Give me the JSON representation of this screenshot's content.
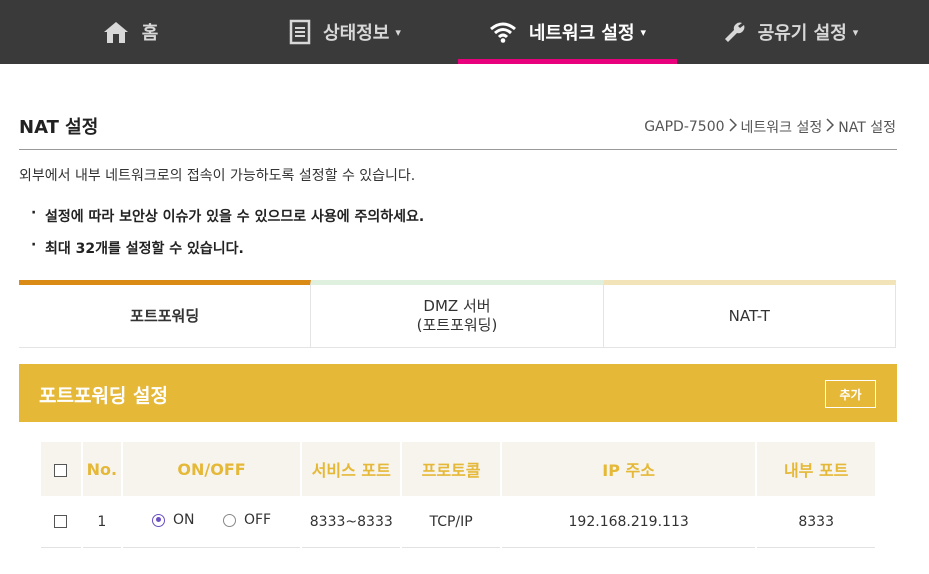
{
  "nav": {
    "items": [
      {
        "label": "홈",
        "icon": "home-icon",
        "caret": ""
      },
      {
        "label": "상태정보",
        "icon": "document-icon",
        "caret": "▾"
      },
      {
        "label": "네트워크 설정",
        "icon": "wifi-icon",
        "caret": "▾"
      },
      {
        "label": "공유기 설정",
        "icon": "wrench-icon",
        "caret": "▾"
      }
    ],
    "active_index": 2,
    "active_color": "#e8007d"
  },
  "page": {
    "title": "NAT 설정",
    "breadcrumb": [
      "GAPD-7500",
      "네트워크 설정",
      "NAT 설정"
    ],
    "description": "외부에서 내부 네트워크로의 접속이 가능하도록 설정할 수 있습니다.",
    "notes": [
      "설정에 따라 보안상 이슈가 있을 수 있으므로 사용에 주의하세요.",
      "최대 32개를 설정할 수 있습니다."
    ]
  },
  "tabs": [
    {
      "label": "포트포워딩",
      "sub": ""
    },
    {
      "label": "DMZ 서버",
      "sub": "(포트포워딩)"
    },
    {
      "label": "NAT-T",
      "sub": ""
    }
  ],
  "section": {
    "title": "포트포워딩 설정",
    "add_label": "추가",
    "accent_color": "#e5b838"
  },
  "table": {
    "headers": [
      "No.",
      "ON/OFF",
      "서비스 포트",
      "프로토콜",
      "IP 주소",
      "내부 포트"
    ],
    "rows": [
      {
        "no": "1",
        "on_label": "ON",
        "off_label": "OFF",
        "state": "ON",
        "service_port": "8333~8333",
        "protocol": "TCP/IP",
        "ip": "192.168.219.113",
        "internal_port": "8333"
      }
    ]
  }
}
